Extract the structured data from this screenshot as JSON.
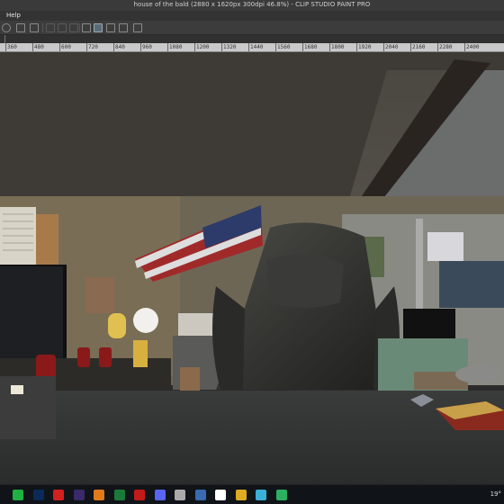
{
  "window": {
    "title": "house of the bald (2880 x 1620px 300dpi 46.8%)  - CLIP STUDIO PAINT PRO"
  },
  "menubar": {
    "items": [
      "Help"
    ]
  },
  "toolbar": {
    "icons": [
      "undo-icon",
      "copy-icon",
      "cut-icon",
      "paste-icon",
      "clear-icon",
      "fill-icon",
      "transform-icon",
      "pen-active-icon",
      "pen-icon",
      "page-icon",
      "link-icon"
    ]
  },
  "ruler": {
    "ticks": [
      "360",
      "480",
      "600",
      "720",
      "840",
      "960",
      "1080",
      "1200",
      "1320",
      "1440",
      "1560",
      "1680",
      "1800",
      "1920",
      "2040",
      "2160",
      "2280",
      "2400"
    ]
  },
  "taskbar": {
    "apps": [
      "line-app",
      "photoshop-app",
      "youtube-music-app",
      "browser-app",
      "blender-app",
      "excel-app",
      "adobe-app",
      "discord-app",
      "figure-app",
      "doc-app",
      "mail-app",
      "files-app",
      "camera-app",
      "maps-app"
    ],
    "tray_text": "19°"
  },
  "colors": {
    "accent": "#5b6b7c",
    "taskbar": "#101418"
  }
}
